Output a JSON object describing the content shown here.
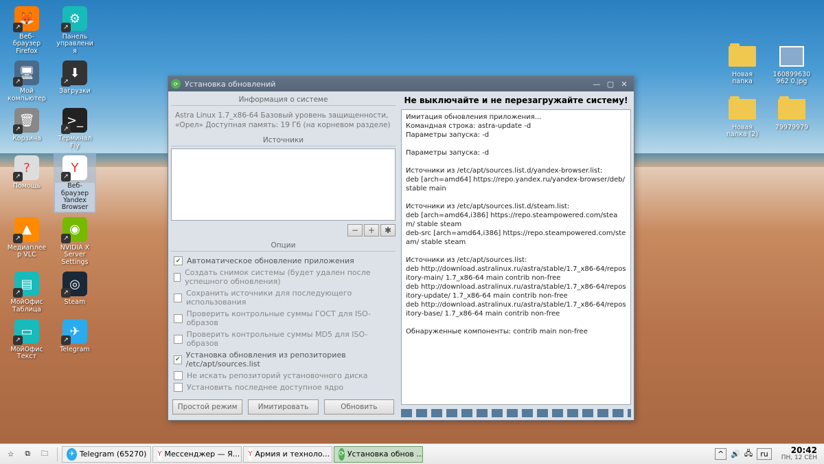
{
  "desktop_icons_left": [
    [
      {
        "label": "Веб-браузер Firefox",
        "icon": "firefox"
      },
      {
        "label": "Панель управления",
        "icon": "panel"
      }
    ],
    [
      {
        "label": "Мой компьютер",
        "icon": "computer"
      },
      {
        "label": "Загрузки",
        "icon": "downloads"
      }
    ],
    [
      {
        "label": "Корзина",
        "icon": "trash"
      },
      {
        "label": "Терминал Fly",
        "icon": "terminal"
      }
    ],
    [
      {
        "label": "Помощь",
        "icon": "help"
      },
      {
        "label": "Веб-браузер Yandex Browser",
        "icon": "yandex",
        "selected": true
      }
    ],
    [
      {
        "label": "Медиаплеер VLC",
        "icon": "vlc"
      },
      {
        "label": "NVIDIA X Server Settings",
        "icon": "nvidia"
      }
    ],
    [
      {
        "label": "МойОфис Таблица",
        "icon": "table"
      },
      {
        "label": "Steam",
        "icon": "steam"
      }
    ],
    [
      {
        "label": "МойОфис Текст",
        "icon": "text"
      },
      {
        "label": "Telegram",
        "icon": "telegram"
      }
    ]
  ],
  "desktop_icons_right": [
    {
      "label": "Новая папка",
      "icon": "folder"
    },
    {
      "label": "160899630962 0.jpg",
      "icon": "image"
    },
    {
      "label": "Новая папка (2)",
      "icon": "folder"
    },
    {
      "label": "79979979",
      "icon": "folder"
    }
  ],
  "window": {
    "title": "Установка обновлений",
    "info_header": "Информация о системе",
    "info_lines": "Astra Linux 1.7_x86-64\nБазовый уровень защищенности, «Орел»\nДоступная память: 19 Гб (на корневом разделе)",
    "sources_header": "Источники",
    "options_header": "Опции",
    "options": [
      {
        "label": "Автоматическое обновление приложения",
        "checked": true
      },
      {
        "label": "Создать снимок системы (будет удален после успешного обновления)",
        "checked": false
      },
      {
        "label": "Сохранить источники для последующего использования",
        "checked": false
      },
      {
        "label": "Проверить контрольные суммы ГОСТ для ISO-образов",
        "checked": false
      },
      {
        "label": "Проверить контрольные суммы MD5 для ISO-образов",
        "checked": false
      },
      {
        "label": "Установка обновления из репозиториев /etc/apt/sources.list",
        "checked": true
      },
      {
        "label": "Не искать репозиторий установочного диска",
        "checked": false
      },
      {
        "label": "Установить последнее доступное ядро",
        "checked": false
      }
    ],
    "buttons": {
      "simple": "Простой режим",
      "simulate": "Имитировать",
      "update": "Обновить"
    },
    "warning": "Не выключайте и не перезагружайте систему!",
    "log": "Имитация обновления приложения...\nКомандная строка: astra-update -d\nПараметры запуска: -d\n\nПараметры запуска: -d\n\nИсточники из /etc/apt/sources.list.d/yandex-browser.list:\ndeb [arch=amd64] https://repo.yandex.ru/yandex-browser/deb/ stable main\n\nИсточники из /etc/apt/sources.list.d/steam.list:\ndeb [arch=amd64,i386] https://repo.steampowered.com/steam/ stable steam\ndeb-src [arch=amd64,i386] https://repo.steampowered.com/steam/ stable steam\n\nИсточники из /etc/apt/sources.list:\ndeb http://download.astralinux.ru/astra/stable/1.7_x86-64/repository-main/ 1.7_x86-64 main contrib non-free\ndeb http://download.astralinux.ru/astra/stable/1.7_x86-64/repository-update/ 1.7_x86-64 main contrib non-free\ndeb http://download.astralinux.ru/astra/stable/1.7_x86-64/repository-base/ 1.7_x86-64 main contrib non-free\n\nОбнаруженные компоненты: contrib main non-free"
  },
  "taskbar": {
    "tasks": [
      {
        "label": "Telegram (65270)",
        "icon": "telegram"
      },
      {
        "label": "Мессенджер — Я...",
        "icon": "yandex"
      },
      {
        "label": "Армия и техноло...",
        "icon": "yandex"
      },
      {
        "label": "Установка обнов ...",
        "icon": "update",
        "active": true
      }
    ],
    "lang": "ru",
    "time": "20:42",
    "date": "ПН, 12 СЕН"
  },
  "icon_colors": {
    "firefox": "#ff7a00",
    "panel": "#18baba",
    "computer": "#4a6a8a",
    "downloads": "#333",
    "trash": "#888",
    "terminal": "#222",
    "help": "#ddd",
    "yandex": "#fff",
    "vlc": "#ff8a00",
    "nvidia": "#76b900",
    "table": "#18baba",
    "steam": "#1b2838",
    "text": "#18baba",
    "telegram": "#2aabee",
    "folder": "#f0c850",
    "image": "#88aacc",
    "update": "#4fb050"
  },
  "icon_glyphs": {
    "firefox": "🦊",
    "panel": "⚙",
    "computer": "🖥",
    "downloads": "⬇",
    "trash": "🗑",
    "terminal": ">_",
    "help": "?",
    "yandex": "Y",
    "vlc": "▲",
    "nvidia": "◉",
    "table": "▤",
    "steam": "◎",
    "text": "▭",
    "telegram": "✈",
    "folder": "",
    "image": "🖼",
    "update": "⟳"
  }
}
